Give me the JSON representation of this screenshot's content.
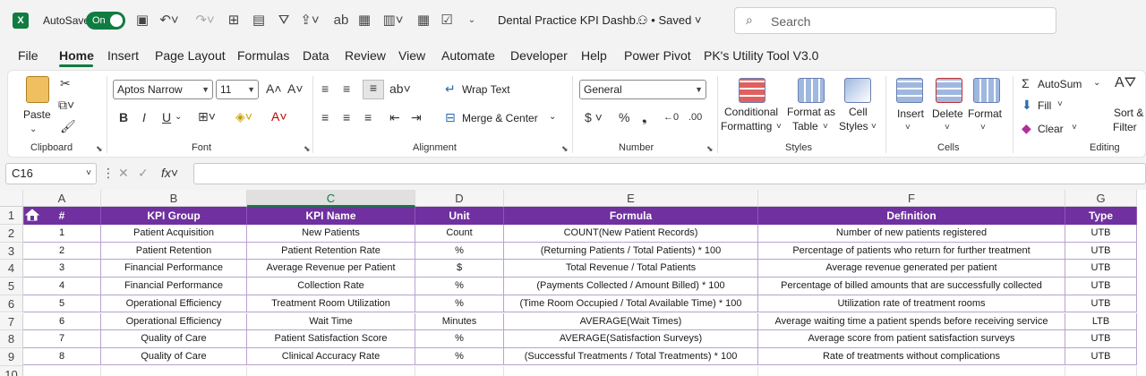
{
  "titlebar": {
    "app_icon": "X",
    "autosave_label": "AutoSave",
    "toggle_label": "On",
    "doc_title": "Dental Practice KPI Dashb...",
    "saved_label": "• Saved",
    "search_placeholder": "Search"
  },
  "menu": {
    "tabs": [
      "File",
      "Home",
      "Insert",
      "Page Layout",
      "Formulas",
      "Data",
      "Review",
      "View",
      "Automate",
      "Developer",
      "Help",
      "Power Pivot",
      "PK's Utility Tool V3.0"
    ],
    "active": "Home"
  },
  "ribbon": {
    "clipboard": {
      "paste": "Paste",
      "label": "Clipboard"
    },
    "font": {
      "name": "Aptos Narrow",
      "size": "11",
      "label": "Font",
      "bold": "B",
      "italic": "I",
      "underline": "U"
    },
    "alignment": {
      "wrap_text": "Wrap Text",
      "merge_center": "Merge & Center",
      "label": "Alignment"
    },
    "number": {
      "format": "General",
      "label": "Number"
    },
    "styles": {
      "conditional_1": "Conditional",
      "conditional_2": "Formatting",
      "format_as_1": "Format as",
      "format_as_2": "Table",
      "cell_styles_1": "Cell",
      "cell_styles_2": "Styles",
      "label": "Styles"
    },
    "cells": {
      "insert": "Insert",
      "delete": "Delete",
      "format": "Format",
      "label": "Cells"
    },
    "editing": {
      "autosum": "AutoSum",
      "fill": "Fill",
      "clear": "Clear",
      "sort_1": "Sort &",
      "sort_2": "Filter",
      "label": "Editing"
    }
  },
  "formula_bar": {
    "name_box": "C16",
    "fx": "fx",
    "formula": ""
  },
  "grid": {
    "columns": [
      "A",
      "B",
      "C",
      "D",
      "E",
      "F",
      "G"
    ],
    "selected_column": "C",
    "row_numbers": [
      "1",
      "2",
      "3",
      "4",
      "5",
      "6",
      "7",
      "8",
      "9",
      "10"
    ],
    "headers": [
      "#",
      "KPI Group",
      "KPI Name",
      "Unit",
      "Formula",
      "Definition",
      "Type"
    ],
    "rows": [
      [
        "1",
        "Patient Acquisition",
        "New Patients",
        "Count",
        "COUNT(New Patient Records)",
        "Number of new patients registered",
        "UTB"
      ],
      [
        "2",
        "Patient Retention",
        "Patient Retention Rate",
        "%",
        "(Returning Patients / Total Patients) * 100",
        "Percentage of patients who return for further treatment",
        "UTB"
      ],
      [
        "3",
        "Financial Performance",
        "Average Revenue per Patient",
        "$",
        "Total Revenue / Total Patients",
        "Average revenue generated per patient",
        "UTB"
      ],
      [
        "4",
        "Financial Performance",
        "Collection Rate",
        "%",
        "(Payments Collected / Amount Billed) * 100",
        "Percentage of billed amounts that are successfully collected",
        "UTB"
      ],
      [
        "5",
        "Operational Efficiency",
        "Treatment Room Utilization",
        "%",
        "(Time Room Occupied / Total Available Time) * 100",
        "Utilization rate of treatment rooms",
        "UTB"
      ],
      [
        "6",
        "Operational Efficiency",
        "Wait Time",
        "Minutes",
        "AVERAGE(Wait Times)",
        "Average waiting time a patient spends before receiving service",
        "LTB"
      ],
      [
        "7",
        "Quality of Care",
        "Patient Satisfaction Score",
        "%",
        "AVERAGE(Satisfaction Surveys)",
        "Average score from patient satisfaction surveys",
        "UTB"
      ],
      [
        "8",
        "Quality of Care",
        "Clinical Accuracy Rate",
        "%",
        "(Successful Treatments / Total Treatments) * 100",
        "Rate of treatments without complications",
        "UTB"
      ]
    ],
    "header_color": "#7030a0",
    "accent_color": "#107c41"
  }
}
